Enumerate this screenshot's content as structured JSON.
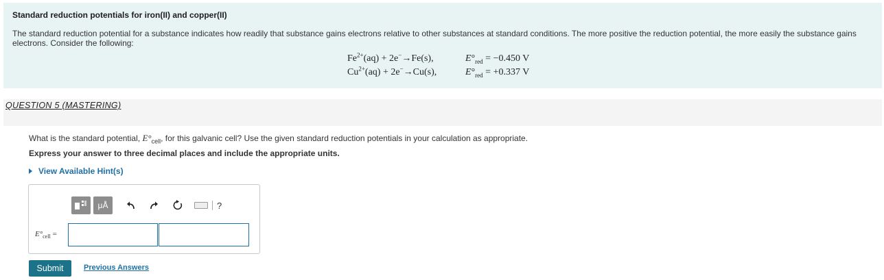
{
  "intro": {
    "title": "Standard reduction potentials for iron(II) and copper(II)",
    "text": "The standard reduction potential for a substance indicates how readily that substance gains electrons relative to other substances at standard conditions. The more positive the reduction potential, the more easily the substance gains electrons. Consider the following:",
    "equations": [
      {
        "species": "Fe",
        "charge": "2+",
        "rest": "(aq) + 2e",
        "minus": "−",
        "arrow": "→",
        "product": "Fe(s),",
        "e_symbol": "E",
        "deg": "°",
        "sub": "red",
        "value": "= −0.450 V"
      },
      {
        "species": "Cu",
        "charge": "2+",
        "rest": "(aq) + 2e",
        "minus": "−",
        "arrow": "→",
        "product": "Cu(s),",
        "e_symbol": "E",
        "deg": "°",
        "sub": "red",
        "value": "= +0.337 V"
      }
    ]
  },
  "question": {
    "header": "QUESTION 5 (MASTERING)",
    "prompt_before": "What is the standard potential, ",
    "prompt_symbol": "E°",
    "prompt_sub": "cell",
    "prompt_after": ", for this galvanic cell? Use the given standard reduction potentials in your calculation as appropriate.",
    "instruction": "Express your answer to three decimal places and include the appropriate units.",
    "hint_label": "View Available Hint(s)"
  },
  "answer": {
    "label_symbol": "E°",
    "label_sub": "cell",
    "label_equals": "=",
    "value": "",
    "unit": "",
    "toolbar": {
      "units_label": "μÅ",
      "help_label": "?"
    }
  },
  "actions": {
    "submit_label": "Submit",
    "previous_answers_label": "Previous Answers"
  },
  "colors": {
    "intro_bg": "#e8f4f3",
    "link": "#1f6fa5",
    "submit_bg": "#1b7289",
    "toolbar_btn": "#8d8d8d"
  }
}
